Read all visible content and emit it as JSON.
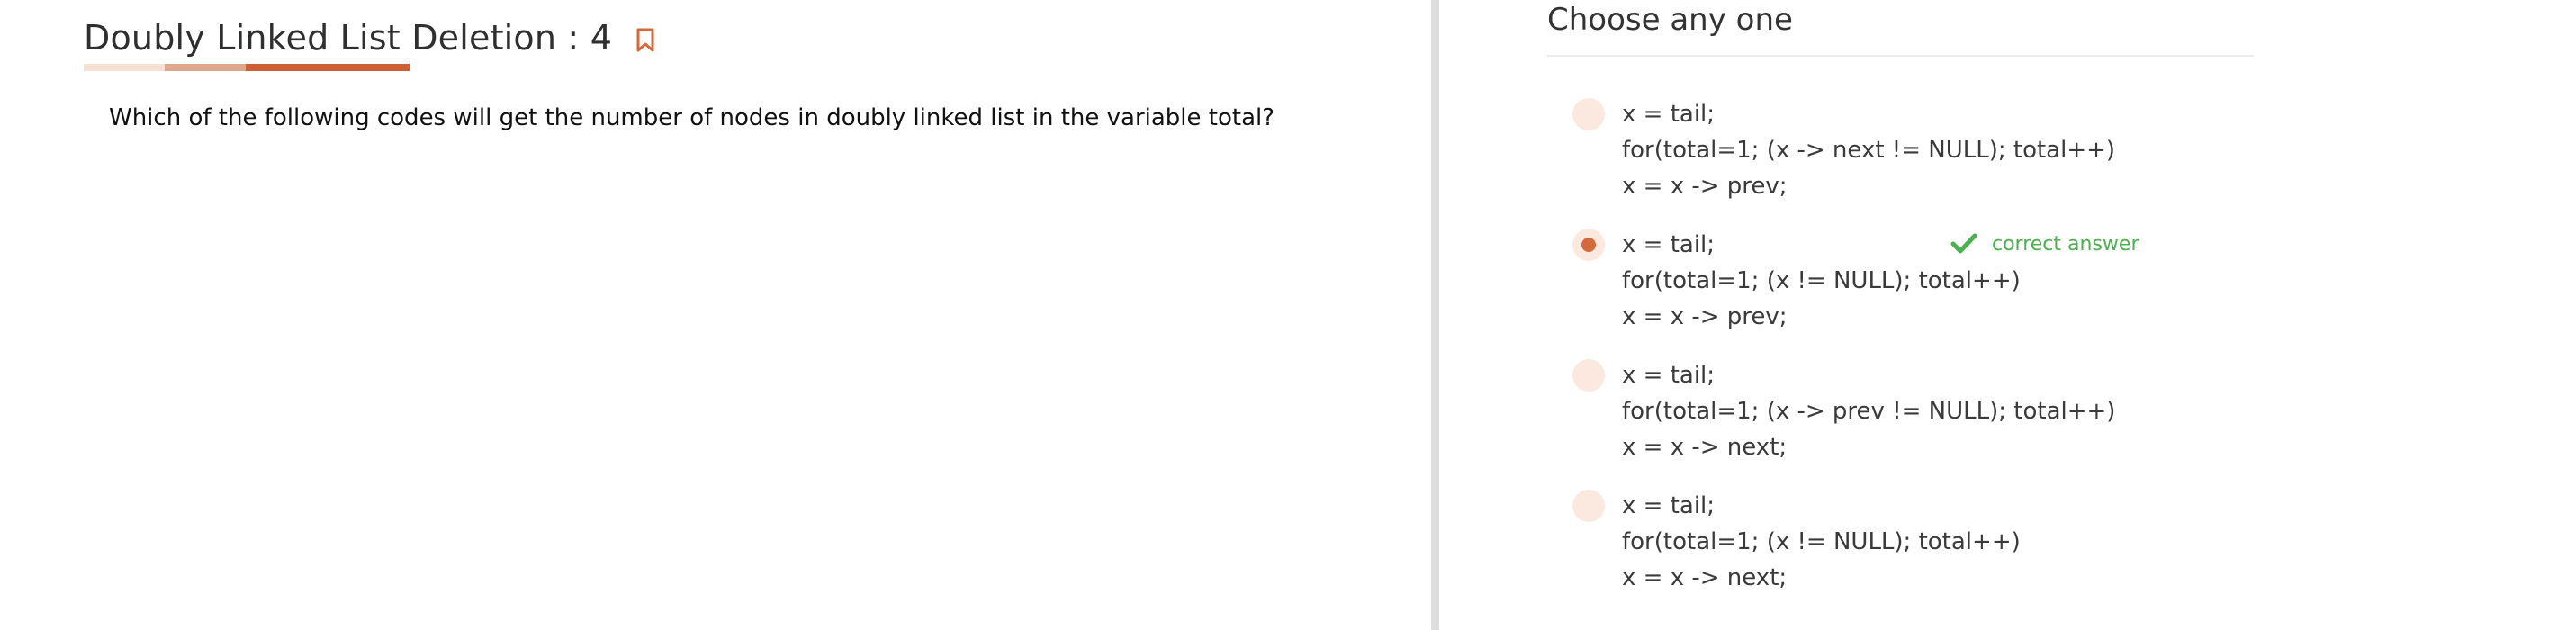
{
  "question": {
    "title": "Doubly Linked List Deletion : 4",
    "text": "Which of the following codes will get the number of nodes in doubly linked list in the variable total?",
    "progress_segments": [
      "#f7e1d5",
      "#dea68a",
      "#cc5f35"
    ]
  },
  "answers": {
    "heading": "Choose any one",
    "correct_label": "correct answer",
    "selected_index": 1,
    "options": [
      {
        "lines": [
          "x = tail;",
          "for(total=1; (x -> next != NULL); total++)",
          "x = x -> prev;"
        ]
      },
      {
        "lines": [
          "x = tail;",
          "for(total=1; (x != NULL); total++)",
          "x = x -> prev;"
        ]
      },
      {
        "lines": [
          "x = tail;",
          "for(total=1; (x -> prev != NULL); total++)",
          "x = x -> next;"
        ]
      },
      {
        "lines": [
          "x = tail;",
          "for(total=1; (x != NULL); total++)",
          "x = x -> next;"
        ]
      }
    ]
  },
  "colors": {
    "accent": "#d4693b",
    "radio_bg": "#fbe8de",
    "correct": "#4caf50",
    "divider": "#dedede"
  },
  "icons": {
    "bookmark": "bookmark-icon",
    "check": "check-icon"
  }
}
